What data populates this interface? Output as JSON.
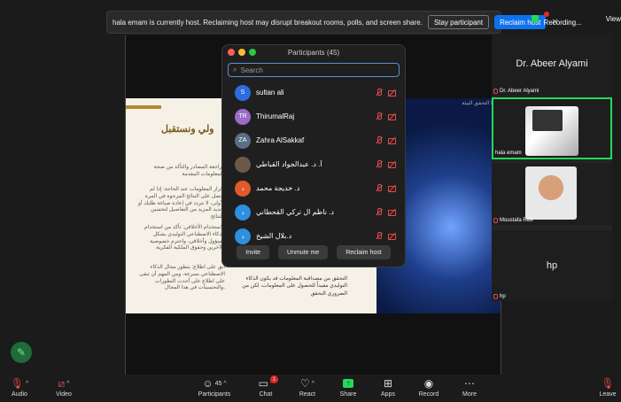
{
  "banner": {
    "message": "hala emam is currently host. Reclaiming host may disrupt breakout rooms, polls, and screen share.",
    "stay_label": "Stay participant",
    "reclaim_label": "Reclaim host",
    "close": "✕"
  },
  "status": {
    "recording": "Recording...",
    "view": "View"
  },
  "participants_panel": {
    "title": "Participants (45)",
    "search_placeholder": "Search",
    "rows": [
      {
        "initials": "S",
        "name": "sultan ali",
        "color": "#2d6cdf"
      },
      {
        "initials": "TR",
        "name": "ThirumalRaj",
        "color": "#9b6bc9"
      },
      {
        "initials": "ZA",
        "name": "Zahra AlSakkaf",
        "color": "#5a6e86"
      },
      {
        "initials": "",
        "name": "أ. د. عبدالجواد القباطي",
        "color": "#6b5a4a"
      },
      {
        "initials": "د",
        "name": "د. خديجة محمد",
        "color": "#e05a2b"
      },
      {
        "initials": "د",
        "name": "د. ناظم ال تركي القحطاني",
        "color": "#2d8fdf"
      },
      {
        "initials": "د",
        "name": "د.بلال الشيخ",
        "color": "#2d8fdf"
      }
    ],
    "invite_label": "Invite",
    "unmute_label": "Unmute me",
    "reclaim_label": "Reclaim host"
  },
  "gallery": {
    "speaker_big": "Dr. Abeer Alyami",
    "speaker_label": "Dr. Abeer Alyami",
    "hala_label": "hala emam",
    "moustafa_label": "Moustafa Rizk",
    "hp_big": "hp",
    "hp_label": "hp"
  },
  "slide": {
    "title": "ولي ونستقبل",
    "tag": "ما التحقق البيئة",
    "para1": "مراجعة المصادر والتأكد من صحة المعلومات المقدمة.",
    "para2": "تكرار المعلومات عند الحاجة: إذا لم تحصل على النتائج المرجوة في المرة الأولى، لا تتردد في إعادة صياغة طلبك أو تحديد المزيد من التفاصيل لتحسين النتائج.",
    "para3": "الاستخدام الأخلاقي: تأكد من استخدام الذكاء الاصطناعي التوليدي بشكل مسؤول وأخلاقي، واحترم خصوصية الآخرين وحقوق الملكية الفكرية.",
    "para4": "ابق على اطلاع: يتطور مجال الذكاء الاصطناعي بسرعة، ومن المهم أن تبقى على اطلاع على أحدث التطورات والتحسينات في هذا المجال.",
    "bottom": "التحقق من مصداقية المعلومات قد يكون الذكاء التوليدي مفيداً للحصول على المعلومات، لكن من الضروري التحقق"
  },
  "toolbar": {
    "audio": "Audio",
    "video": "Video",
    "participants": "Participants",
    "participants_count": "45",
    "chat": "Chat",
    "chat_badge": "1",
    "react": "React",
    "share": "Share",
    "apps": "Apps",
    "record": "Record",
    "more": "More",
    "leave": "Leave"
  }
}
